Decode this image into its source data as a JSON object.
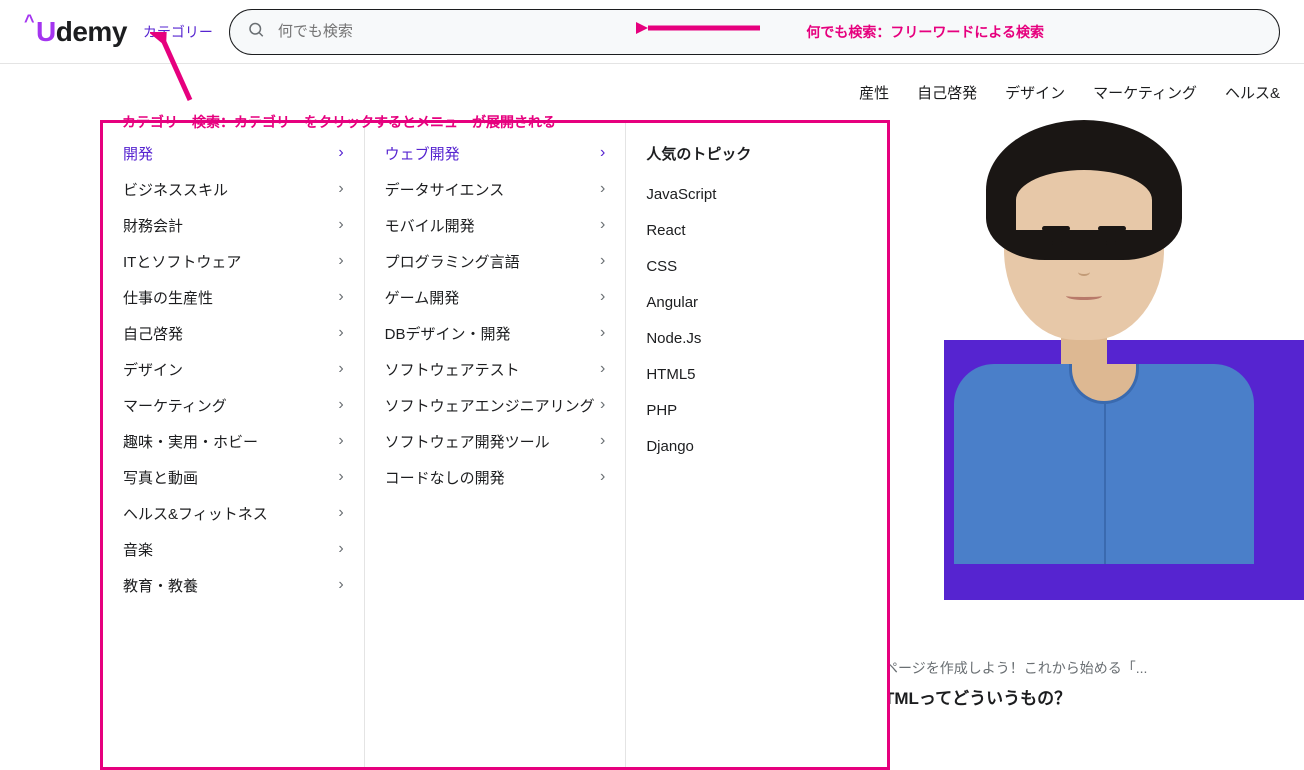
{
  "header": {
    "logo_text": "demy",
    "categories_link": "カテゴリー",
    "search_placeholder": "何でも検索"
  },
  "navbar": {
    "items": [
      "産性",
      "自己啓発",
      "デザイン",
      "マーケティング",
      "ヘルス&"
    ]
  },
  "annotations": {
    "search": "何でも検索：フリーワードによる検索",
    "category": "カテゴリー検索：カテゴリーをクリックするとメニューが展開される"
  },
  "mega_menu": {
    "col1": {
      "active_index": 0,
      "items": [
        "開発",
        "ビジネススキル",
        "財務会計",
        "ITとソフトウェア",
        "仕事の生産性",
        "自己啓発",
        "デザイン",
        "マーケティング",
        "趣味・実用・ホビー",
        "写真と動画",
        "ヘルス&フィットネス",
        "音楽",
        "教育・教養"
      ]
    },
    "col2": {
      "active_index": 0,
      "items": [
        "ウェブ開発",
        "データサイエンス",
        "モバイル開発",
        "プログラミング言語",
        "ゲーム開発",
        "DBデザイン・開発",
        "ソフトウェアテスト",
        "ソフトウェアエンジニアリング",
        "ソフトウェア開発ツール",
        "コードなしの開発"
      ]
    },
    "col3": {
      "title": "人気のトピック",
      "topics": [
        "JavaScript",
        "React",
        "CSS",
        "Angular",
        "Node.Js",
        "HTML5",
        "PHP",
        "Django"
      ]
    }
  },
  "card": {
    "subtitle": "ページを作成しよう！これから始める「...",
    "title": "TMLってどういうもの？"
  },
  "colors": {
    "accent": "#5624d0",
    "brand_purple": "#a435f0",
    "annotation_pink": "#e6007e"
  }
}
